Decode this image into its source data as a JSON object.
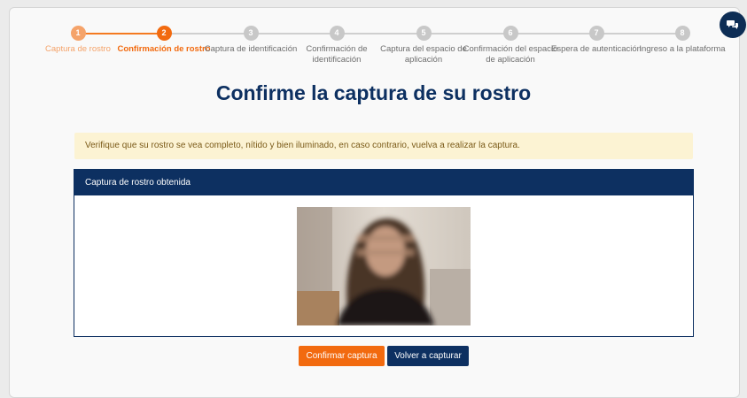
{
  "stepper": {
    "steps": [
      {
        "number": "1",
        "label": "Captura de rostro",
        "state": "done"
      },
      {
        "number": "2",
        "label": "Confirmación de rostro",
        "state": "active"
      },
      {
        "number": "3",
        "label": "Captura de identificación",
        "state": "pending"
      },
      {
        "number": "4",
        "label": "Confirmación de identificación",
        "state": "pending"
      },
      {
        "number": "5",
        "label": "Captura del espacio de aplicación",
        "state": "pending"
      },
      {
        "number": "6",
        "label": "Confirmación del espacio de aplicación",
        "state": "pending"
      },
      {
        "number": "7",
        "label": "Espera de autenticación",
        "state": "pending"
      },
      {
        "number": "8",
        "label": "Ingreso a la plataforma",
        "state": "pending"
      }
    ]
  },
  "page": {
    "title": "Confirme la captura de su rostro",
    "alert": "Verifique que su rostro se vea completo, nítido y bien iluminado, en caso contrario, vuelva a realizar la captura."
  },
  "panel": {
    "header": "Captura de rostro obtenida"
  },
  "actions": {
    "confirm_label": "Confirmar captura",
    "retake_label": "Volver a capturar"
  },
  "chat": {
    "icon": "chat-bubbles-icon"
  },
  "colors": {
    "accent_orange": "#f26a0f",
    "done_orange": "#f5a36a",
    "navy": "#0d3061",
    "alert_bg": "#fcf3d3"
  }
}
